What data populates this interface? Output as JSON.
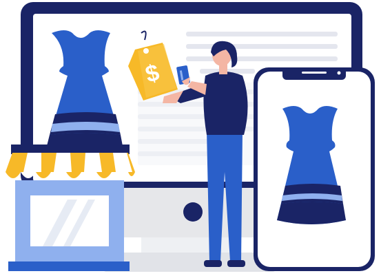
{
  "illustration": {
    "price_tag": {
      "symbol": "$"
    },
    "colors": {
      "navy": "#1a2466",
      "royal_blue": "#2a5fc9",
      "light_blue": "#8fb0ee",
      "pale_blue": "#dfe7f6",
      "gold": "#f7b928",
      "skin": "#f4b6a4",
      "grey": "#e6e7ea",
      "white": "#ffffff"
    }
  }
}
